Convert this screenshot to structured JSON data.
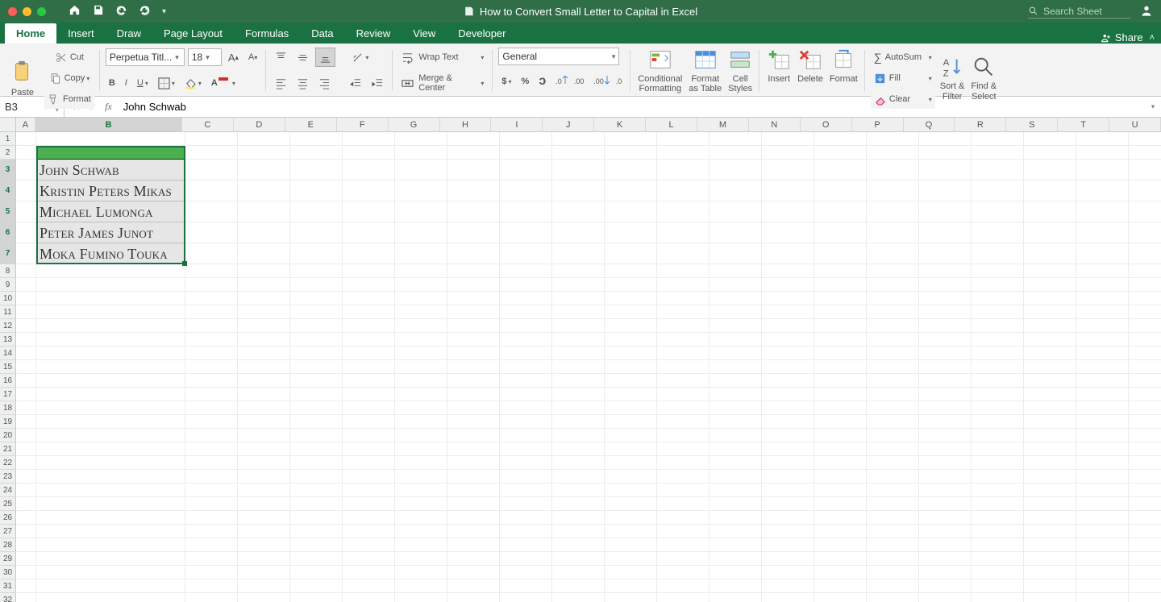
{
  "titlebar": {
    "doc_title": "How to Convert Small Letter to Capital in Excel",
    "search_placeholder": "Search Sheet"
  },
  "tabs": [
    "Home",
    "Insert",
    "Draw",
    "Page Layout",
    "Formulas",
    "Data",
    "Review",
    "View",
    "Developer"
  ],
  "active_tab": "Home",
  "share_label": "Share",
  "clipboard": {
    "paste": "Paste",
    "cut": "Cut",
    "copy": "Copy",
    "format": "Format"
  },
  "font": {
    "name": "Perpetua Titl...",
    "size": "18"
  },
  "alignment": {
    "wrap": "Wrap Text",
    "merge": "Merge & Center"
  },
  "number": {
    "format": "General"
  },
  "styles": {
    "cond": "Conditional\nFormatting",
    "table": "Format\nas Table",
    "cstyles": "Cell\nStyles"
  },
  "cellsg": {
    "insert": "Insert",
    "delete": "Delete",
    "format": "Format"
  },
  "editing": {
    "autosum": "AutoSum",
    "fill": "Fill",
    "clear": "Clear",
    "sort": "Sort &\nFilter",
    "find": "Find &\nSelect"
  },
  "fbar": {
    "name": "B3",
    "formula": "John Schwab"
  },
  "columns": [
    "A",
    "B",
    "C",
    "D",
    "E",
    "F",
    "G",
    "H",
    "I",
    "J",
    "K",
    "L",
    "M",
    "N",
    "O",
    "P",
    "Q",
    "R",
    "S",
    "T",
    "U"
  ],
  "data_rows": [
    "John Schwab",
    "Kristin Peters Mikas",
    "Michael Lumonga",
    "Peter James Junot",
    "Moka Fumino Touka"
  ]
}
